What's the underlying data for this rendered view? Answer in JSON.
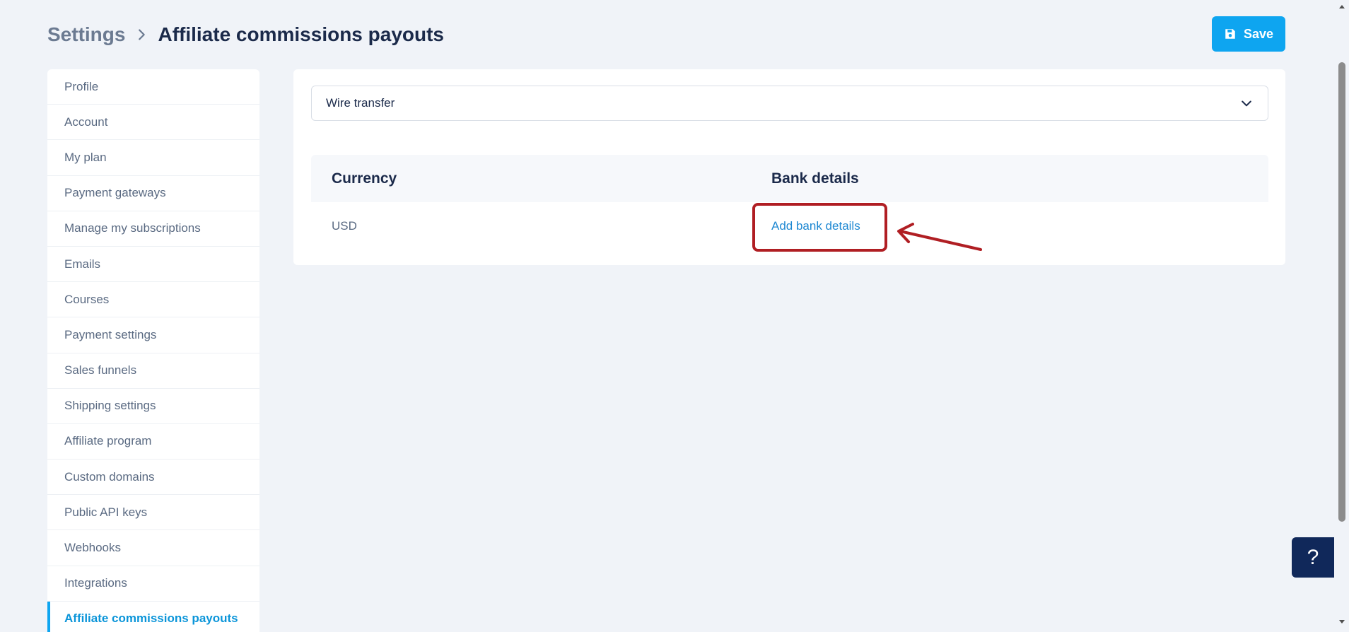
{
  "breadcrumb": {
    "parent": "Settings",
    "current": "Affiliate commissions payouts"
  },
  "toolbar": {
    "save_label": "Save"
  },
  "sidebar": {
    "items": [
      {
        "label": "Profile",
        "active": false
      },
      {
        "label": "Account",
        "active": false
      },
      {
        "label": "My plan",
        "active": false
      },
      {
        "label": "Payment gateways",
        "active": false
      },
      {
        "label": "Manage my subscriptions",
        "active": false
      },
      {
        "label": "Emails",
        "active": false
      },
      {
        "label": "Courses",
        "active": false
      },
      {
        "label": "Payment settings",
        "active": false
      },
      {
        "label": "Sales funnels",
        "active": false
      },
      {
        "label": "Shipping settings",
        "active": false
      },
      {
        "label": "Affiliate program",
        "active": false
      },
      {
        "label": "Custom domains",
        "active": false
      },
      {
        "label": "Public API keys",
        "active": false
      },
      {
        "label": "Webhooks",
        "active": false
      },
      {
        "label": "Integrations",
        "active": false
      },
      {
        "label": "Affiliate commissions payouts",
        "active": true
      }
    ]
  },
  "payout_method": {
    "selected": "Wire transfer"
  },
  "table": {
    "headers": [
      "Currency",
      "Bank details"
    ],
    "rows": [
      {
        "currency": "USD",
        "bank_details_link": "Add bank details"
      }
    ]
  },
  "help": {
    "label": "?"
  },
  "colors": {
    "accent": "#0ea5f0",
    "annotation": "#b01e23",
    "link": "#1e88d2",
    "help_bg": "#10285a"
  },
  "icons": {
    "save": "floppy-disk-icon",
    "breadcrumb_separator": "chevron-right-icon",
    "select": "chevron-down-icon"
  }
}
